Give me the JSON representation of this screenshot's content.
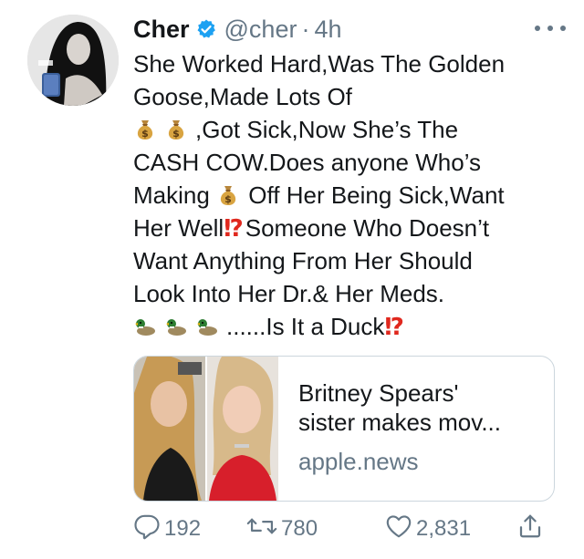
{
  "tweet": {
    "name": "Cher",
    "handle": "@cher",
    "separator": "·",
    "time": "4h",
    "verified_color": "#1da1f2",
    "lines": {
      "l1": "She Worked Hard,Was The Golden",
      "l2": "Goose,Made Lots Of",
      "l3": ",Got Sick,Now She’s The",
      "l4": "CASH COW.Does anyone Who’s",
      "l5a": "Making",
      "l5b": "Off Her Being Sick,Want",
      "l6a": "Her Well",
      "l6b": "Someone Who Doesn’t",
      "l7": "Want Anything From Her Should",
      "l8": "Look Into Her Dr.& Her Meds.",
      "l9": "......Is It a Duck"
    },
    "emoji": {
      "money_bag": "money-bag-icon",
      "duck": "duck-icon",
      "exclamation": "⁉"
    }
  },
  "card": {
    "title_line1": "Britney Spears'",
    "title_line2": "sister makes mov...",
    "domain": "apple.news"
  },
  "actions": {
    "replies": "192",
    "retweets": "780",
    "likes": "2,831"
  },
  "colors": {
    "text": "#14171a",
    "secondary": "#657786",
    "accent": "#1da1f2",
    "exclamation": "#e0281e"
  }
}
